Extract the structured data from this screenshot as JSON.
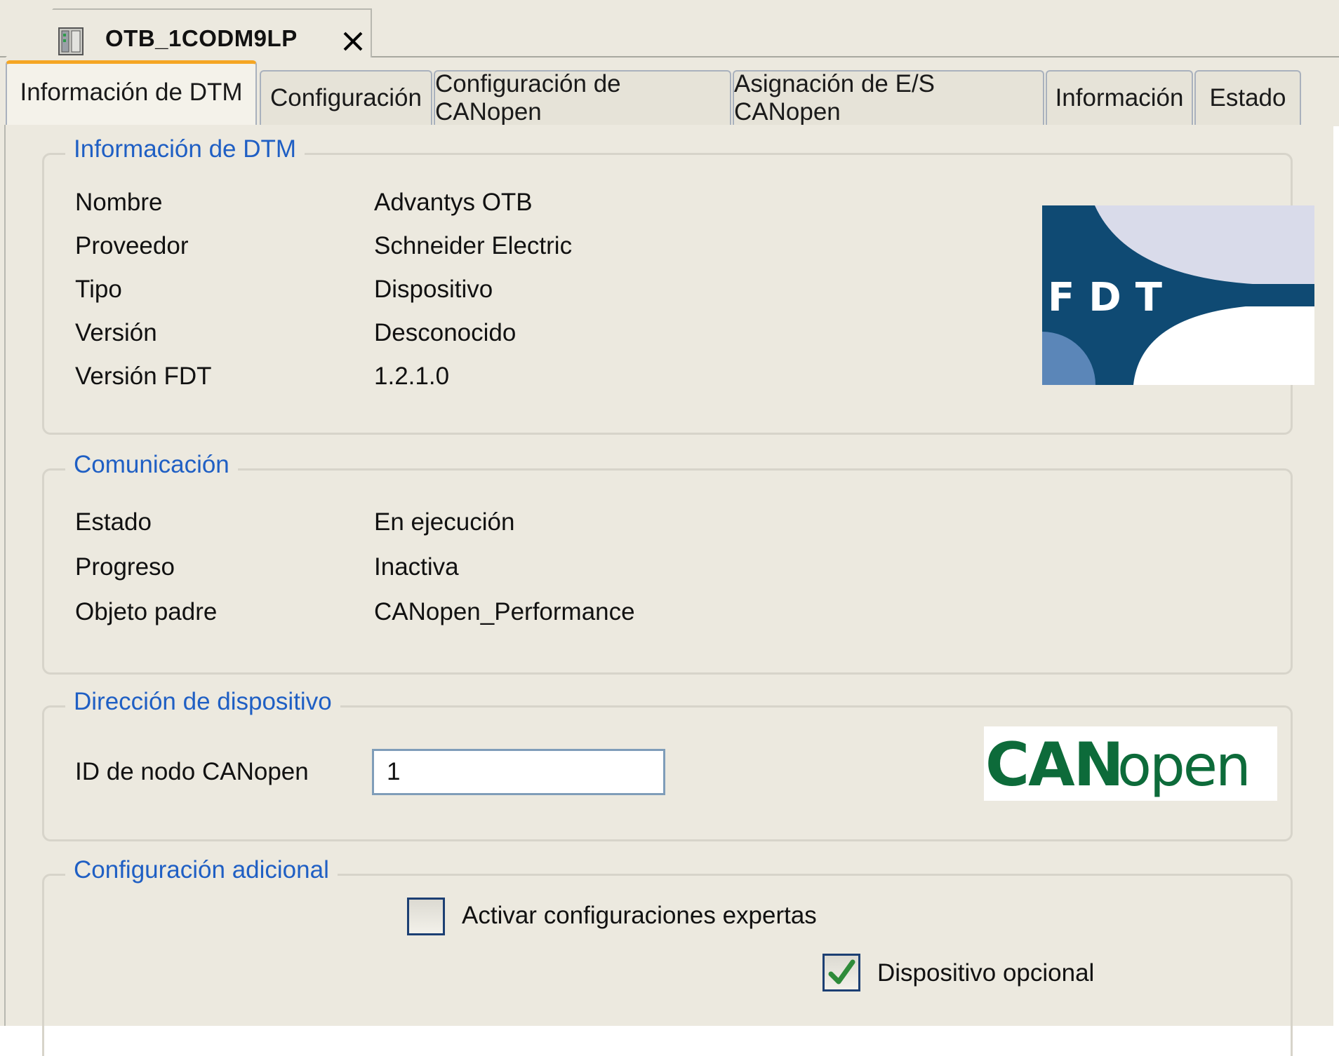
{
  "document_tab": {
    "title": "OTB_1CODM9LP",
    "icon": "device-module-icon",
    "close_icon": "close-icon"
  },
  "tabs": [
    {
      "label": "Información de DTM",
      "active": true
    },
    {
      "label": "Configuración",
      "active": false
    },
    {
      "label": "Configuración de CANopen",
      "active": false
    },
    {
      "label": "Asignación de E/S CANopen",
      "active": false
    },
    {
      "label": "Información",
      "active": false
    },
    {
      "label": "Estado",
      "active": false
    }
  ],
  "dtm_info": {
    "title": "Información de DTM",
    "rows": [
      {
        "label": "Nombre",
        "value": "Advantys OTB"
      },
      {
        "label": "Proveedor",
        "value": "Schneider Electric"
      },
      {
        "label": "Tipo",
        "value": "Dispositivo"
      },
      {
        "label": "Versión",
        "value": "Desconocido"
      },
      {
        "label": "Versión FDT",
        "value": "1.2.1.0"
      }
    ],
    "logo_text": "FDT"
  },
  "communication": {
    "title": "Comunicación",
    "rows": [
      {
        "label": "Estado",
        "value": "En ejecución"
      },
      {
        "label": "Progreso",
        "value": "Inactiva"
      },
      {
        "label": "Objeto padre",
        "value": "CANopen_Performance"
      }
    ]
  },
  "device_address": {
    "title": "Dirección de dispositivo",
    "node_id_label": "ID de nodo CANopen",
    "node_id_value": "1",
    "logo_text_bold": "CAN",
    "logo_text_light": "open"
  },
  "additional_config": {
    "title": "Configuración adicional",
    "expert_label": "Activar configuraciones expertas",
    "expert_checked": false,
    "optional_label": "Dispositivo opcional",
    "optional_checked": true
  },
  "colors": {
    "group_title": "#1f5fc4",
    "active_tab_accent": "#f5a623",
    "fdt_blue": "#0f4a73",
    "canopen_green": "#0d6b3a"
  }
}
